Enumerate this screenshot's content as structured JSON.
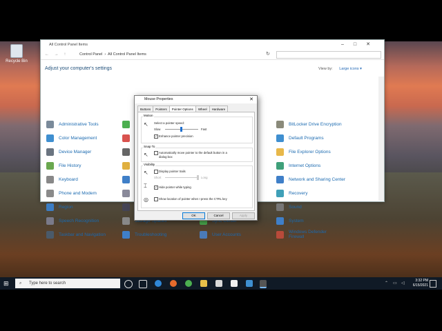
{
  "desktop": {
    "icon_label": "Recycle Bin"
  },
  "window": {
    "title": "All Control Panel Items",
    "breadcrumb": [
      "Control Panel",
      "All Control Panel Items"
    ],
    "heading": "Adjust your computer's settings",
    "view_by_label": "View by:",
    "view_by_value": "Large icons ▾",
    "items": [
      {
        "label": "Administrative Tools",
        "color": "#7a8a9a"
      },
      {
        "label": "Color Management",
        "color": "#3f8fd0"
      },
      {
        "label": "Device Manager",
        "color": "#6a7480"
      },
      {
        "label": "File History",
        "color": "#6aa84f"
      },
      {
        "label": "Keyboard",
        "color": "#888888"
      },
      {
        "label": "Phone and Modem",
        "color": "#8a8a8a"
      },
      {
        "label": "Region",
        "color": "#3b7dc4"
      },
      {
        "label": "Speech Recognition",
        "color": "#7a7a8a"
      },
      {
        "label": "Taskbar and Navigation",
        "color": "#4a5a6a"
      },
      {
        "label": "Storage Spaces",
        "color": "#888888"
      },
      {
        "label": "Troubleshooting",
        "color": "#3f7fc8"
      },
      {
        "label": "Sync Center",
        "color": "#4caf50"
      },
      {
        "label": "User Accounts",
        "color": "#4a7ab8"
      },
      {
        "label": "BitLocker Drive Encryption",
        "color": "#8a8a7a"
      },
      {
        "label": "Default Programs",
        "color": "#3f8fd0"
      },
      {
        "label": "File Explorer Options",
        "color": "#e8b84a"
      },
      {
        "label": "Internet Options",
        "color": "#3fa07a"
      },
      {
        "label": "Network and Sharing Center",
        "color": "#3f7fc8"
      },
      {
        "label": "Recovery",
        "color": "#3fa0b8"
      },
      {
        "label": "Sound",
        "color": "#777777"
      },
      {
        "label": "System",
        "color": "#3f7fc8"
      },
      {
        "label": "Windows Defender Firewall",
        "color": "#b84a3a"
      }
    ]
  },
  "dialog": {
    "title": "Mouse Properties",
    "tabs": [
      "Buttons",
      "Pointers",
      "Pointer Options",
      "Wheel",
      "Hardware"
    ],
    "active_tab": "Pointer Options",
    "motion": {
      "group": "Motion",
      "speed_label": "Select a pointer speed:",
      "slow": "Slow",
      "fast": "Fast",
      "precision": "Enhance pointer precision",
      "precision_checked": "✓"
    },
    "snap": {
      "group": "Snap To",
      "text_line1": "Automatically move pointer to the default button in a",
      "text_line2": "dialog box"
    },
    "visibility": {
      "group": "Visibility",
      "trails": "Display pointer trails",
      "short": "Short",
      "long": "Long",
      "hide": "Hide pointer while typing",
      "hide_checked": "✓",
      "ctrl": "Show location of pointer when I press the CTRL key"
    },
    "buttons": {
      "ok": "OK",
      "cancel": "Cancel",
      "apply": "Apply"
    }
  },
  "taskbar": {
    "search_placeholder": "Type here to search",
    "time": "3:32 PM",
    "date": "6/15/2021"
  }
}
